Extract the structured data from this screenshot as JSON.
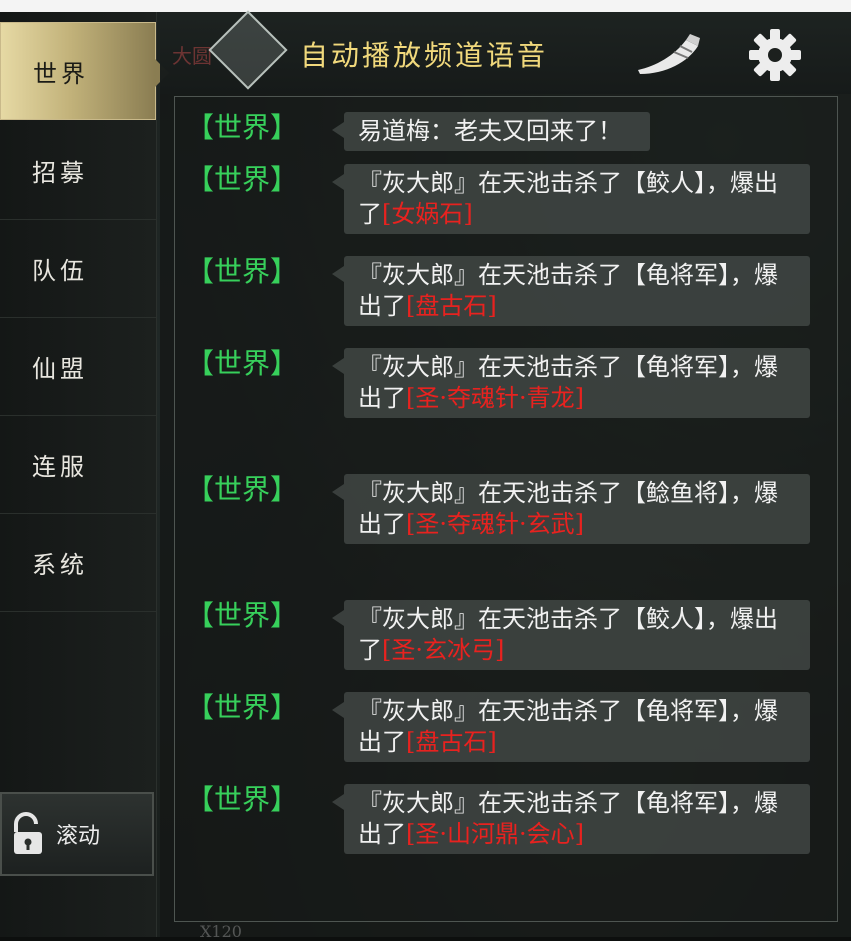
{
  "sidebar": {
    "tabs": [
      {
        "label": "世界",
        "active": true
      },
      {
        "label": "招募",
        "active": false
      },
      {
        "label": "队伍",
        "active": false
      },
      {
        "label": "仙盟",
        "active": false
      },
      {
        "label": "连服",
        "active": false
      },
      {
        "label": "系统",
        "active": false
      }
    ],
    "scroll_label": "滚动",
    "scroll_icon": "unlock-icon"
  },
  "header": {
    "title": "自动播放频道语音",
    "faint_text": "大圆",
    "horn_icon": "horn-icon",
    "settings_icon": "gear-icon"
  },
  "colors": {
    "channel": "#37d05b",
    "item": "#e8221f",
    "title": "#f1d97c",
    "active_tab": "#c2b27a"
  },
  "messages": [
    {
      "channel": "【世界】",
      "text": "易道梅：老夫又回来了！",
      "item": ""
    },
    {
      "channel": "【世界】",
      "text": "『灰大郎』在天池击杀了【鲛人】，爆出了",
      "item": "[女娲石]"
    },
    {
      "channel": "【世界】",
      "text": "『灰大郎』在天池击杀了【龟将军】，爆出了",
      "item": "[盘古石]"
    },
    {
      "channel": "【世界】",
      "text": "『灰大郎』在天池击杀了【龟将军】，爆出了",
      "item": "[圣·夺魂针·青龙]"
    },
    {
      "channel": "【世界】",
      "text": "『灰大郎』在天池击杀了【鲶鱼将】，爆出了",
      "item": "[圣·夺魂针·玄武]"
    },
    {
      "channel": "【世界】",
      "text": "『灰大郎』在天池击杀了【鲛人】，爆出了",
      "item": "[圣·玄冰弓]"
    },
    {
      "channel": "【世界】",
      "text": "『灰大郎』在天池击杀了【龟将军】，爆出了",
      "item": "[盘古石]"
    },
    {
      "channel": "【世界】",
      "text": "『灰大郎』在天池击杀了【龟将军】，爆出了",
      "item": "[圣·山河鼎·会心]"
    }
  ],
  "footer_faint": "X120"
}
